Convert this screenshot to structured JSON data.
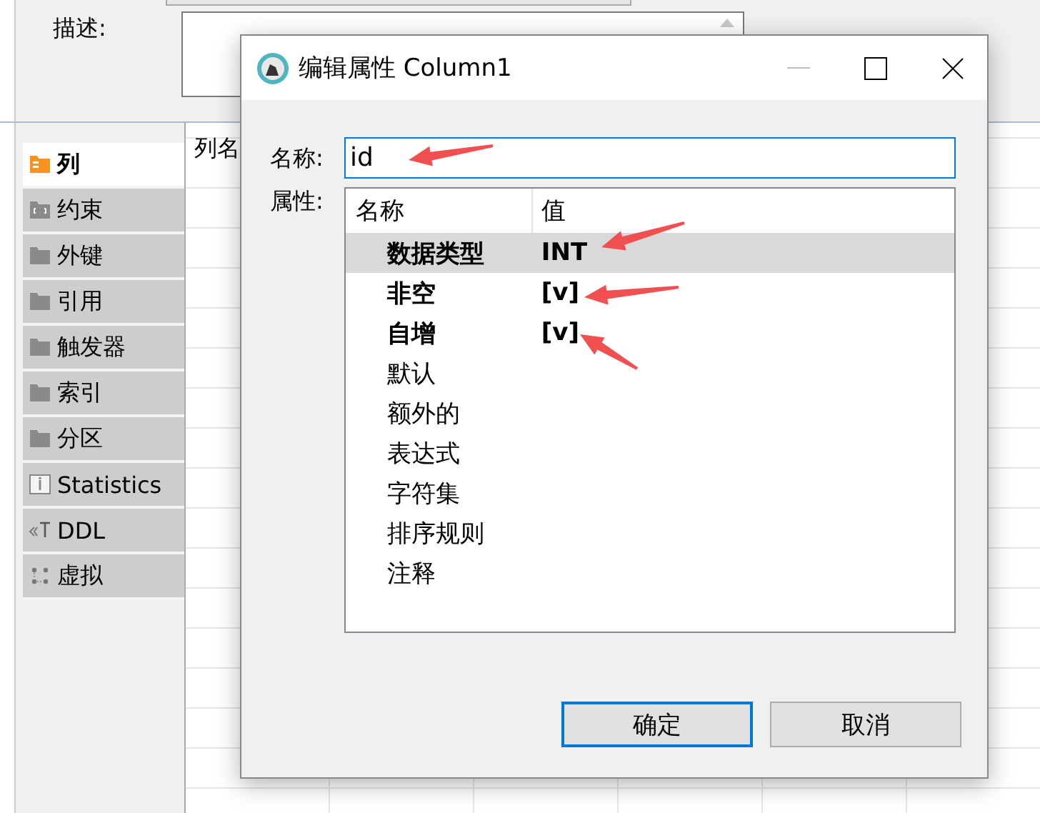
{
  "background": {
    "description_label": "描述:",
    "grid_header": "列名",
    "tabs": [
      {
        "label": "列",
        "kind": "columns",
        "selected": true
      },
      {
        "label": "约束",
        "kind": "constraint",
        "selected": false
      },
      {
        "label": "外键",
        "kind": "folder",
        "selected": false
      },
      {
        "label": "引用",
        "kind": "folder",
        "selected": false
      },
      {
        "label": "触发器",
        "kind": "folder",
        "selected": false
      },
      {
        "label": "索引",
        "kind": "folder",
        "selected": false
      },
      {
        "label": "分区",
        "kind": "folder",
        "selected": false
      },
      {
        "label": "Statistics",
        "kind": "info",
        "selected": false
      },
      {
        "label": "DDL",
        "kind": "ddl",
        "selected": false
      },
      {
        "label": "虚拟",
        "kind": "virtual",
        "selected": false
      }
    ]
  },
  "dialog": {
    "title": "编辑属性 Column1",
    "name_label": "名称:",
    "name_value": "id",
    "properties_label": "属性:",
    "table": {
      "columns": [
        "名称",
        "值"
      ],
      "rows": [
        {
          "name": "数据类型",
          "value": "INT",
          "bold": true,
          "selected": true
        },
        {
          "name": "非空",
          "value": "[v]",
          "bold": true,
          "selected": false
        },
        {
          "name": "自增",
          "value": "[v]",
          "bold": true,
          "selected": false
        },
        {
          "name": "默认",
          "bold": false,
          "selected": false
        },
        {
          "name": "额外的",
          "bold": false,
          "selected": false
        },
        {
          "name": "表达式",
          "bold": false,
          "selected": false
        },
        {
          "name": "字符集",
          "bold": false,
          "selected": false
        },
        {
          "name": "排序规则",
          "bold": false,
          "selected": false
        },
        {
          "name": "注释",
          "bold": false,
          "selected": false
        }
      ]
    },
    "buttons": [
      {
        "label": "确定",
        "default": true
      },
      {
        "label": "取消",
        "default": false
      }
    ]
  }
}
